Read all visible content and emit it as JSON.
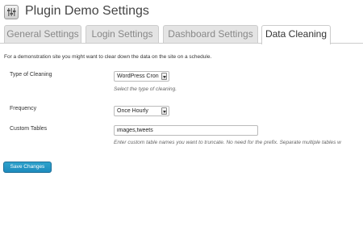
{
  "header": {
    "title": "Plugin Demo Settings",
    "icon": "settings-sliders-icon"
  },
  "tabs": [
    {
      "label": "General Settings",
      "active": false
    },
    {
      "label": "Login Settings",
      "active": false
    },
    {
      "label": "Dashboard Settings",
      "active": false
    },
    {
      "label": "Data Cleaning",
      "active": true
    }
  ],
  "intro": "For a demonstration site you might want to clear down the data on the site on a schedule.",
  "fields": {
    "type_of_cleaning": {
      "label": "Type of Cleaning",
      "value": "WordPress Cron",
      "description": "Select the type of cleaning."
    },
    "frequency": {
      "label": "Frequency",
      "value": "Once Hourly"
    },
    "custom_tables": {
      "label": "Custom Tables",
      "value": "images,tweets",
      "description": "Enter custom table names you want to truncate. No need for the prefix. Separate multiple tables w"
    }
  },
  "save_button": "Save Changes",
  "colors": {
    "accent": "#2ea2cc",
    "tab_inactive_bg": "#e4e4e4",
    "border": "#cccccc"
  }
}
